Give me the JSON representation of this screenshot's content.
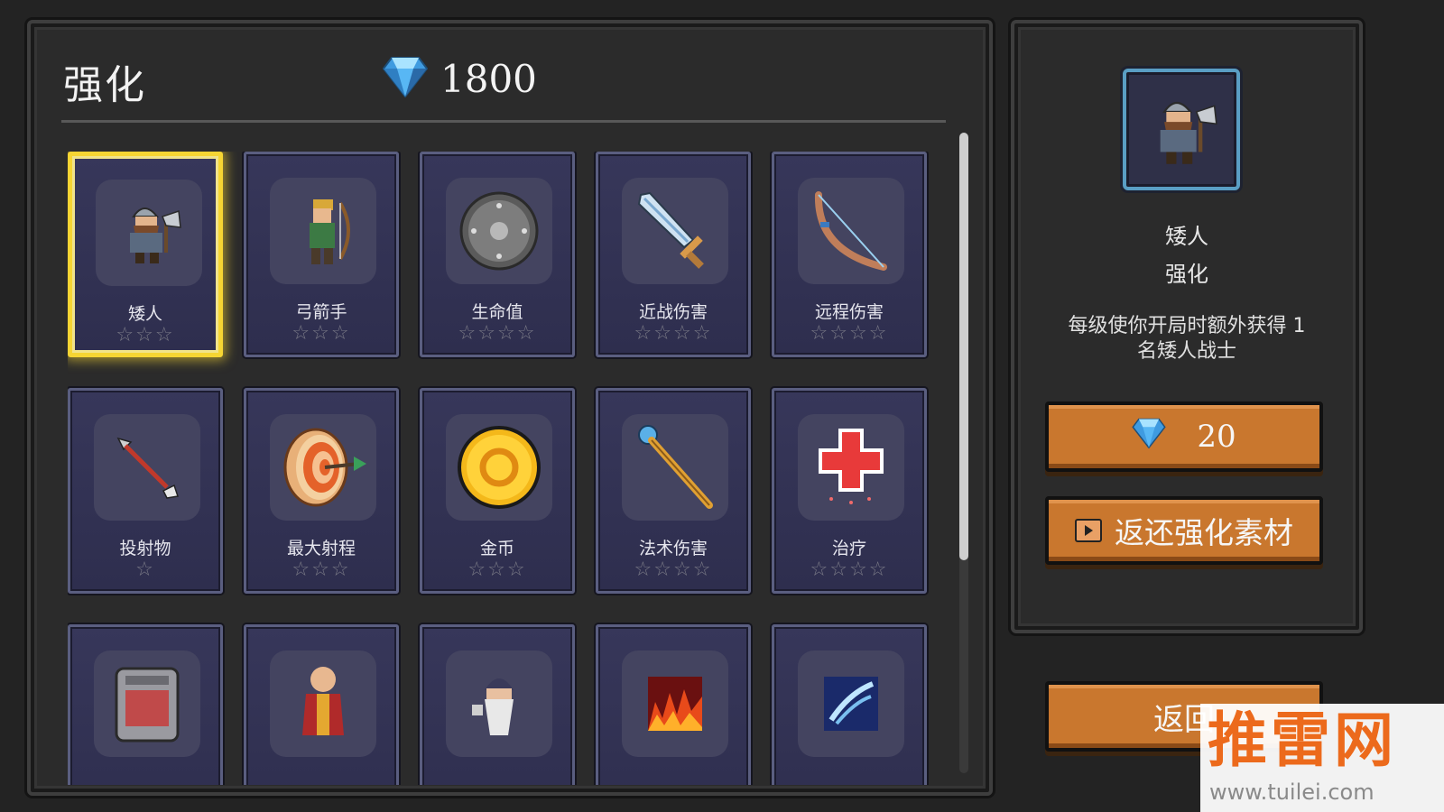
{
  "header": {
    "title": "强化",
    "gem_count": "1800"
  },
  "grid": {
    "cards": [
      {
        "label": "矮人",
        "stars": "☆☆☆",
        "icon": "dwarf-icon",
        "selected": true
      },
      {
        "label": "弓箭手",
        "stars": "☆☆☆",
        "icon": "archer-icon"
      },
      {
        "label": "生命值",
        "stars": "☆☆☆☆",
        "icon": "shield-icon"
      },
      {
        "label": "近战伤害",
        "stars": "☆☆☆☆",
        "icon": "sword-icon"
      },
      {
        "label": "远程伤害",
        "stars": "☆☆☆☆",
        "icon": "bow-icon"
      },
      {
        "label": "投射物",
        "stars": "☆",
        "icon": "arrow-icon"
      },
      {
        "label": "最大射程",
        "stars": "☆☆☆",
        "icon": "target-icon"
      },
      {
        "label": "金币",
        "stars": "☆☆☆",
        "icon": "coin-icon"
      },
      {
        "label": "法术伤害",
        "stars": "☆☆☆☆",
        "icon": "staff-icon"
      },
      {
        "label": "治疗",
        "stars": "☆☆☆☆",
        "icon": "heal-cross-icon"
      },
      {
        "label": "",
        "stars": "",
        "icon": "machine-icon"
      },
      {
        "label": "",
        "stars": "",
        "icon": "monk-icon"
      },
      {
        "label": "",
        "stars": "",
        "icon": "wizard-icon"
      },
      {
        "label": "",
        "stars": "",
        "icon": "fire-icon"
      },
      {
        "label": "",
        "stars": "",
        "icon": "frost-icon"
      }
    ]
  },
  "detail": {
    "name": "矮人",
    "subtitle": "强化",
    "description": "每级使你开局时额外获得 1 名矮人战士",
    "cost": "20",
    "refund_label": "返还强化素材",
    "back_label": "返回"
  },
  "watermark": {
    "logo": "推雷网",
    "url": "www.tuilei.com"
  },
  "colors": {
    "panel_bg": "#2b2b2b",
    "card_bg": "#37375a",
    "selected_border": "#f6d533",
    "button_orange": "#c9772e",
    "gem_blue": "#4fb4f0"
  }
}
